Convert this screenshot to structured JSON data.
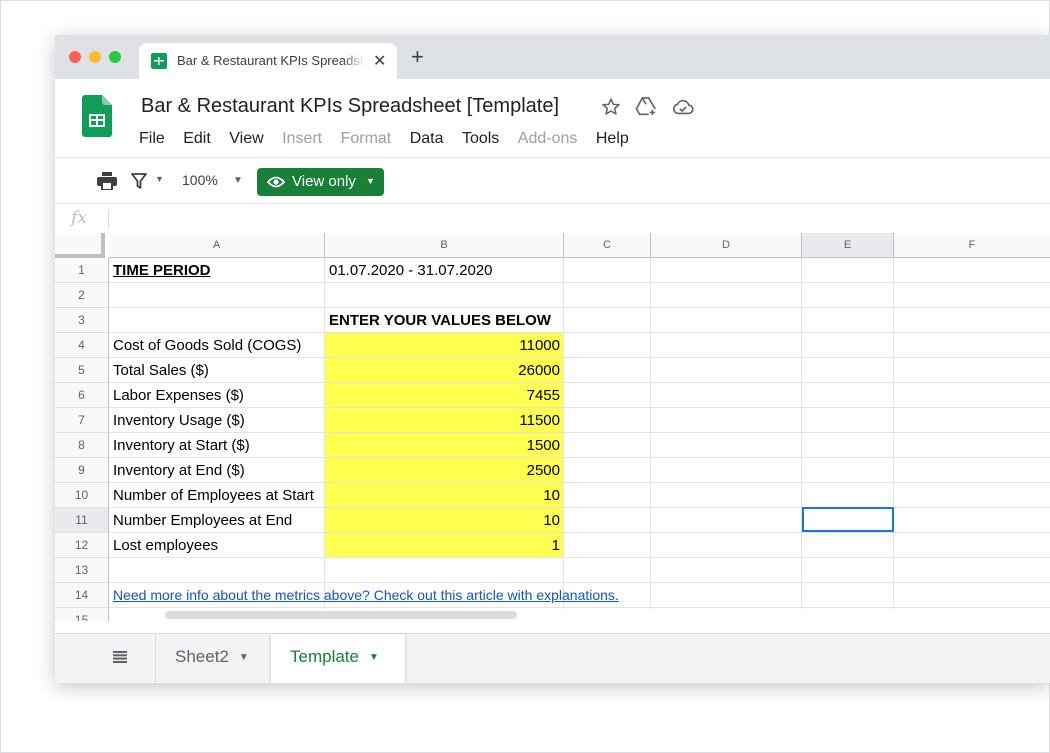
{
  "browser": {
    "tab_title": "Bar & Restaurant KPIs Spreadsheet [Template]",
    "close_glyph": "✕",
    "new_tab_glyph": "+"
  },
  "header": {
    "doc_title": "Bar & Restaurant KPIs Spreadsheet [Template]",
    "icons": [
      "star-icon",
      "move-to-drive-icon",
      "cloud-status-icon"
    ],
    "menus": [
      {
        "label": "File",
        "enabled": true
      },
      {
        "label": "Edit",
        "enabled": true
      },
      {
        "label": "View",
        "enabled": true
      },
      {
        "label": "Insert",
        "enabled": false
      },
      {
        "label": "Format",
        "enabled": false
      },
      {
        "label": "Data",
        "enabled": true
      },
      {
        "label": "Tools",
        "enabled": true
      },
      {
        "label": "Add-ons",
        "enabled": false
      },
      {
        "label": "Help",
        "enabled": true
      }
    ]
  },
  "toolbar": {
    "zoom": "100%",
    "view_only_label": "View only",
    "caret": "▼"
  },
  "formula_bar": {
    "fx_label": "fx",
    "value": ""
  },
  "grid": {
    "columns": [
      "A",
      "B",
      "C",
      "D",
      "E",
      "F"
    ],
    "selected_column": "E",
    "selected_row": "11",
    "rows": [
      "1",
      "2",
      "3",
      "4",
      "5",
      "6",
      "7",
      "8",
      "9",
      "10",
      "11",
      "12",
      "13",
      "14",
      "15"
    ],
    "cells": {
      "a1": "TIME PERIOD",
      "b1": "01.07.2020 - 31.07.2020",
      "b3": "ENTER YOUR VALUES BELOW",
      "a4": "Cost of Goods Sold (COGS)",
      "b4": "11000",
      "a5": "Total Sales ($)",
      "b5": "26000",
      "a6": "Labor Expenses ($)",
      "b6": "7455",
      "a7": "Inventory Usage ($)",
      "b7": "11500",
      "a8": "Inventory at Start ($)",
      "b8": "1500",
      "a9": "Inventory at End ($)",
      "b9": "2500",
      "a10": "Number of Employees at Start",
      "b10": "10",
      "a11": "Number Employees at End",
      "b11": "10",
      "a12": "Lost employees",
      "b12": "1",
      "a14": "Need more info about the metrics above? Check out this article with explanations."
    },
    "input_fill_color": "#ffff4f",
    "link_color": "#1155cc"
  },
  "sheets": {
    "tabs": [
      {
        "label": "Sheet2",
        "active": false
      },
      {
        "label": "Template",
        "active": true
      }
    ],
    "caret": "▼",
    "active_color": "#188038"
  }
}
